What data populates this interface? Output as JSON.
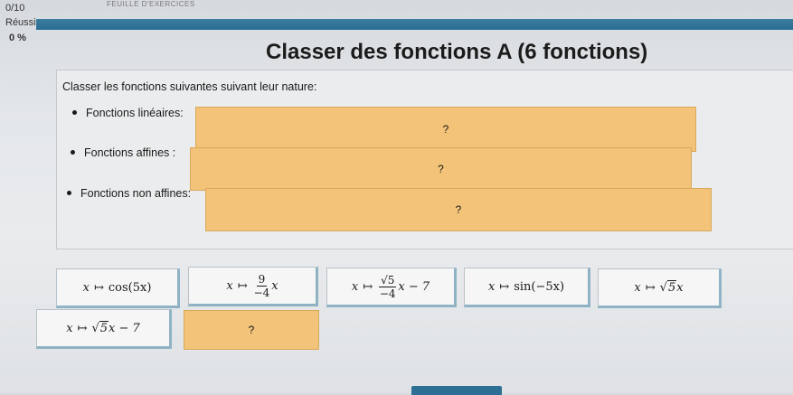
{
  "header": {
    "score": "0/10",
    "reussite_label": "Réussi",
    "percent": "0 %",
    "breadcrumb": "FEUILLE D'EXERCICES"
  },
  "exercise": {
    "title": "Classer des fonctions A (6 fonctions)",
    "instruction": "Classer les fonctions suivantes suivant leur nature:",
    "categories": [
      {
        "label": "Fonctions linéaires:",
        "placeholder": "?"
      },
      {
        "label": "Fonctions affines :",
        "placeholder": "?"
      },
      {
        "label": "Fonctions non affines:",
        "placeholder": "?"
      }
    ]
  },
  "cards": {
    "c1": {
      "var": "x",
      "arrow": "↦",
      "expr": "cos(5x)"
    },
    "c2": {
      "var": "x",
      "arrow": "↦",
      "num": "9",
      "den": "−4",
      "tail": "x"
    },
    "c3": {
      "var": "x",
      "arrow": "↦",
      "num": "√5",
      "den": "−4",
      "tail": "x − 7"
    },
    "c4": {
      "var": "x",
      "arrow": "↦",
      "expr": "sin(−5x)"
    },
    "c5": {
      "var": "x",
      "arrow": "↦",
      "radicand": "5",
      "tail": "x"
    },
    "c6": {
      "var": "x",
      "arrow": "↦",
      "radicand": "5",
      "tail": "x − 7"
    },
    "empty_slot": "?"
  },
  "colors": {
    "dropzone": "#f2c378",
    "accent_blue": "#2b6d93",
    "card_border": "#8fb3c4"
  }
}
